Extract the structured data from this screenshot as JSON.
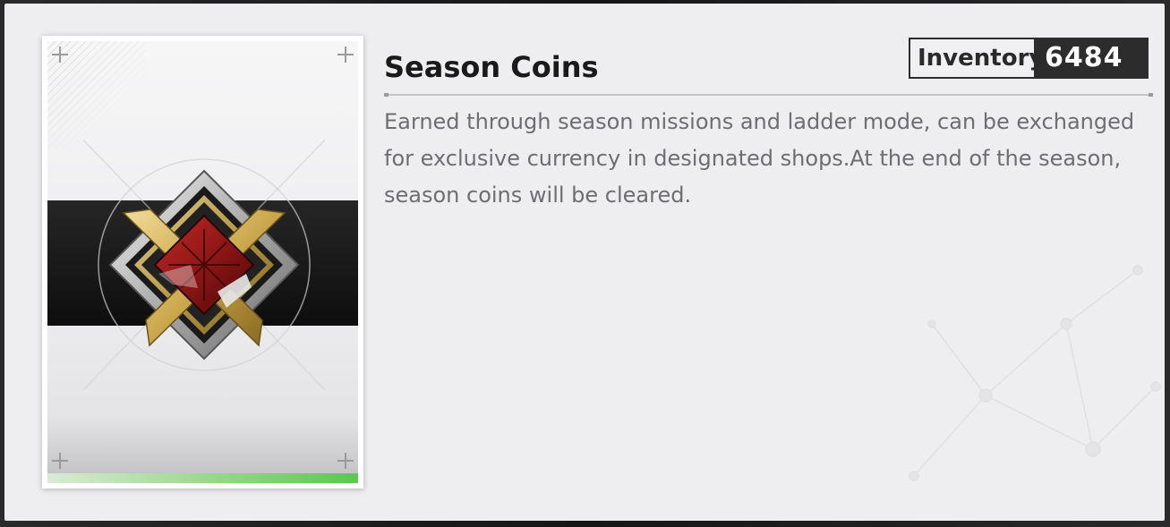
{
  "item": {
    "name": "Season Coins",
    "description": "Earned through season missions and ladder mode, can be exchanged for exclusive currency in designated shops.At the end of the season, season coins will be cleared.",
    "icon": "season-coin-emblem",
    "rarity_color": "#5cc651"
  },
  "inventory": {
    "label": "Inventory",
    "count": "6484"
  },
  "colors": {
    "panel_background": "#eeeef0",
    "title_text": "#1a1a1a",
    "description_text": "#6e6e72",
    "emblem_red": "#8e1616",
    "emblem_gold": "#c9a64a"
  }
}
